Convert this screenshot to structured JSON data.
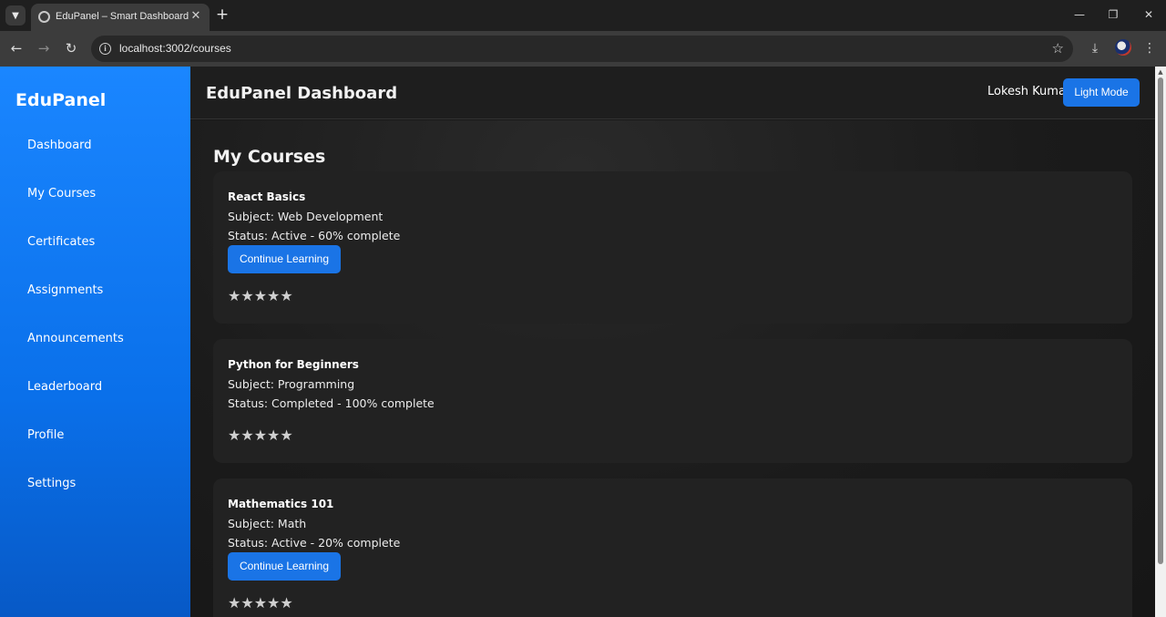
{
  "browser": {
    "tab_title": "EduPanel – Smart Dashboard",
    "url": "localhost:3002/courses",
    "icons": {
      "tab_list": "chevron-down-icon",
      "favicon": "globe-icon",
      "close_tab": "close-icon",
      "new_tab": "plus-icon",
      "back": "back-arrow-icon",
      "forward": "forward-arrow-icon",
      "reload": "reload-icon",
      "site_info": "info-icon",
      "bookmark": "star-icon",
      "downloads": "download-icon",
      "menu": "kebab-menu-icon"
    }
  },
  "sidebar": {
    "brand": "EduPanel",
    "items": [
      {
        "label": "Dashboard"
      },
      {
        "label": "My Courses"
      },
      {
        "label": "Certificates"
      },
      {
        "label": "Assignments"
      },
      {
        "label": "Announcements"
      },
      {
        "label": "Leaderboard"
      },
      {
        "label": "Profile"
      },
      {
        "label": "Settings"
      }
    ]
  },
  "header": {
    "title": "EduPanel Dashboard",
    "user_name": "Lokesh Kumar",
    "mode_button": "Light Mode"
  },
  "main": {
    "section_title": "My Courses",
    "courses": [
      {
        "name": "React Basics",
        "subject": "Subject: Web Development",
        "status": "Status: Active - 60% complete",
        "button": "Continue Learning",
        "rating_stars": "★★★★★"
      },
      {
        "name": "Python for Beginners",
        "subject": "Subject: Programming",
        "status": "Status: Completed - 100% complete",
        "button": "",
        "rating_stars": "★★★★★"
      },
      {
        "name": "Mathematics 101",
        "subject": "Subject: Math",
        "status": "Status: Active - 20% complete",
        "button": "Continue Learning",
        "rating_stars": "★★★★★"
      }
    ]
  },
  "colors": {
    "sidebar_top": "#1a86ff",
    "sidebar_bottom": "#0759c6",
    "accent_button": "#1a74e6",
    "card_bg": "#222222",
    "page_bg": "#181818"
  }
}
